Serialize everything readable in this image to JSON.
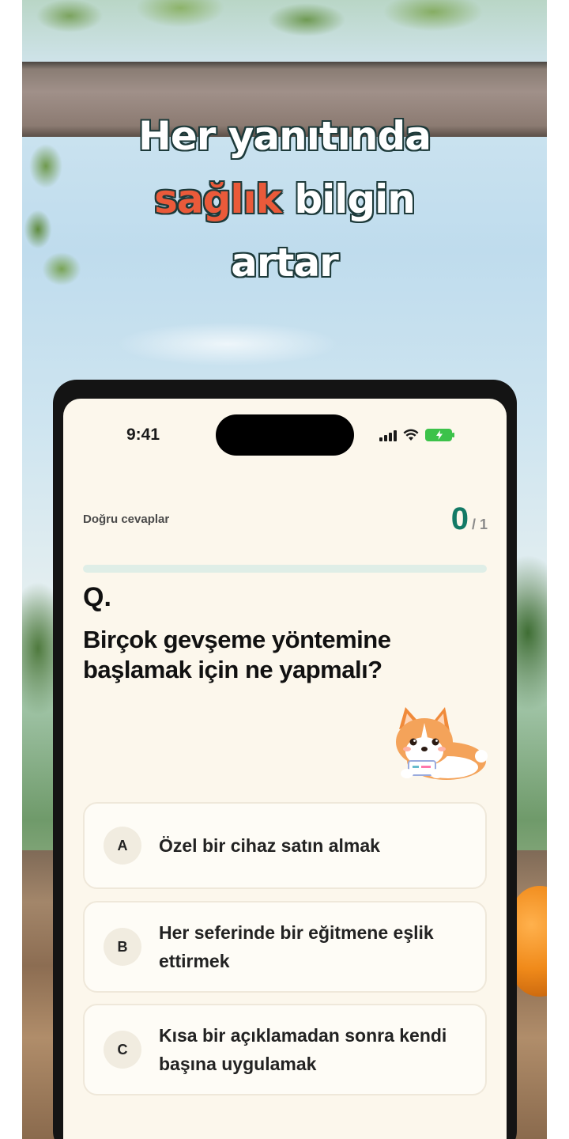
{
  "headline": {
    "line1": "Her yanıtında",
    "line2_highlight": "sağlık",
    "line2_rest": " bilgin",
    "line3": "artar"
  },
  "status_bar": {
    "time": "9:41",
    "icons": [
      "cellular-signal-icon",
      "wifi-icon",
      "battery-charging-icon"
    ]
  },
  "quiz": {
    "score_label": "Doğru cevaplar",
    "score": "0",
    "score_total": "/ 1",
    "progress_fraction": 0,
    "question_marker": "Q.",
    "question": "Birçok gevşeme yöntemine başlamak için ne yapmalı?",
    "options": [
      {
        "letter": "A",
        "text": "Özel bir cihaz satın almak"
      },
      {
        "letter": "B",
        "text": "Her seferinde bir eğitmene eşlik ettirmek"
      },
      {
        "letter": "C",
        "text": "Kısa bir açıklamadan sonra kendi başına uygulamak"
      }
    ]
  },
  "colors": {
    "accent": "#137a66",
    "highlight": "#ea5a3a",
    "screen_bg": "#fcf7ec"
  }
}
